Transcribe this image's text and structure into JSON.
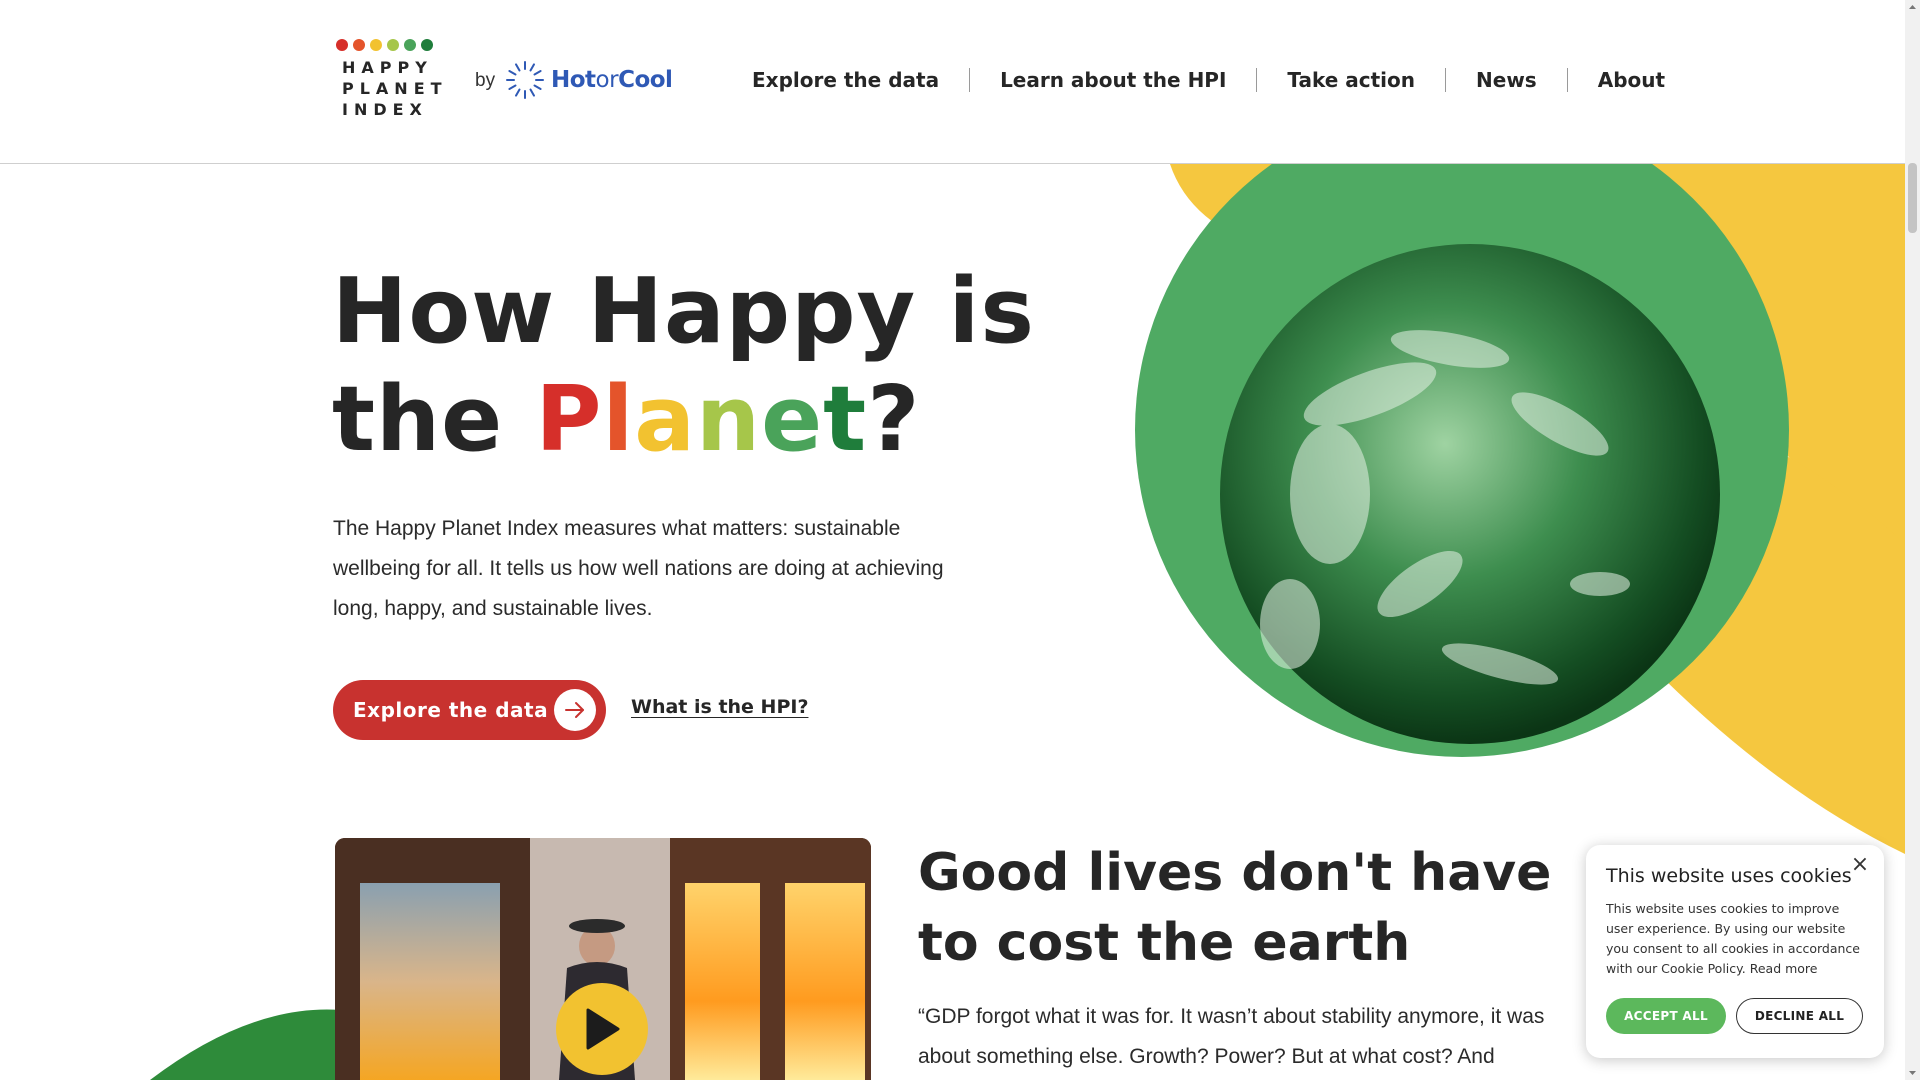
{
  "header": {
    "logo_lines": [
      "HAPPY",
      "PLANET",
      "INDEX"
    ],
    "logo_dot_colors": [
      "#d62f2a",
      "#e4542b",
      "#f2c230",
      "#a6c64a",
      "#4aa35a",
      "#1f7d3b"
    ],
    "by_label": "by",
    "partner_part1": "Hot",
    "partner_part2": "or",
    "partner_part3": "Cool",
    "nav": [
      "Explore the data",
      "Learn about the HPI",
      "Take action",
      "News",
      "About"
    ]
  },
  "hero": {
    "title_line1": "How Happy is",
    "title_line2_prefix": "the ",
    "title_planet_letters": [
      "P",
      "l",
      "a",
      "n",
      "e",
      "t"
    ],
    "title_planet_colors": [
      "#d62f2a",
      "#e4542b",
      "#f2c230",
      "#a6c64a",
      "#4aa35a",
      "#1f7d3b"
    ],
    "title_suffix": "?",
    "description": "The Happy Planet Index measures what matters: sustainable wellbeing for all. It tells us how well nations are doing at achieving long, happy, and sustainable lives.",
    "cta_primary": "Explore the data",
    "cta_secondary": "What is the HPI?"
  },
  "section": {
    "title": "Good lives don't have to cost the earth",
    "quote": "“GDP forgot what it was for. It wasn’t about stability anymore, it was about something else. Growth? Power? But at what cost? And"
  },
  "cookie": {
    "title": "This website uses cookies",
    "text": "This website uses cookies to improve user experience. By using our website you consent to all cookies in accordance with our Cookie Policy.",
    "read_more": "Read more",
    "accept": "ACCEPT ALL",
    "decline": "DECLINE ALL",
    "close_symbol": "×"
  },
  "colors": {
    "brand_red": "#c8322f",
    "yellow": "#f2c230",
    "green": "#4faa63",
    "dark_text": "#262626",
    "accept_green": "#5cb85c",
    "partner_blue": "#2f59b5"
  }
}
